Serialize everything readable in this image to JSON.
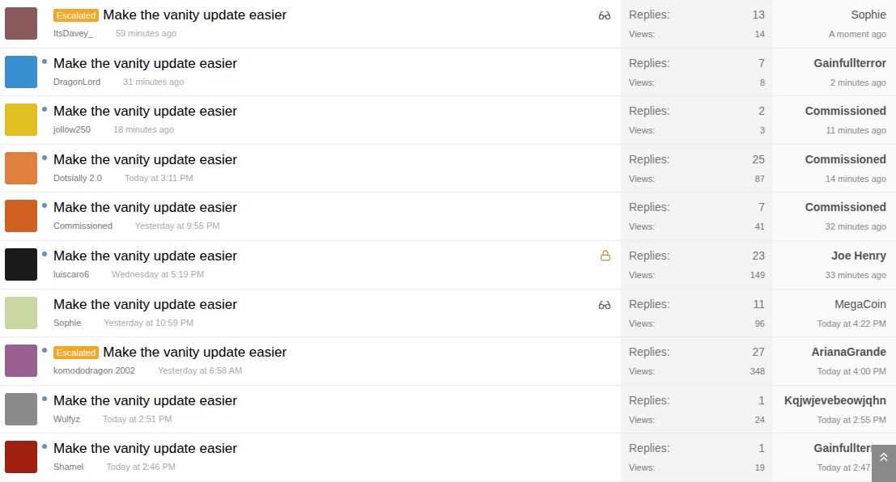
{
  "threads": [
    {
      "badge": "Escalated",
      "title": "Make the vanity update easier",
      "author": "ItsDavey_",
      "started": "59 minutes ago",
      "unread": false,
      "watched": true,
      "locked": false,
      "replies_label": "Replies:",
      "replies": "13",
      "views_label": "Views:",
      "views": "14",
      "last_poster": "Sophie",
      "last_time": "A moment ago",
      "color": "#8a5a5a"
    },
    {
      "badge": "",
      "title": "Make the vanity update easier",
      "author": "DragonLord",
      "started": "31 minutes ago",
      "unread": true,
      "watched": false,
      "locked": false,
      "replies_label": "Replies:",
      "replies": "7",
      "views_label": "Views:",
      "views": "8",
      "last_poster": "Gainfullterror",
      "last_time": "2 minutes ago",
      "color": "#3a8fd0"
    },
    {
      "badge": "",
      "title": "Make the vanity update easier",
      "author": "jollow250",
      "started": "18 minutes ago",
      "unread": true,
      "watched": false,
      "locked": false,
      "replies_label": "Replies:",
      "replies": "2",
      "views_label": "Views:",
      "views": "3",
      "last_poster": "Commissioned",
      "last_time": "11 minutes ago",
      "color": "#e0c020"
    },
    {
      "badge": "",
      "title": "Make the vanity update easier",
      "author": "Dotsially 2.0",
      "started": "Today at 3:11 PM",
      "unread": true,
      "watched": false,
      "locked": false,
      "replies_label": "Replies:",
      "replies": "25",
      "views_label": "Views:",
      "views": "87",
      "last_poster": "Commissioned",
      "last_time": "14 minutes ago",
      "color": "#e08040"
    },
    {
      "badge": "",
      "title": "Make the vanity update easier",
      "author": "Commissioned",
      "started": "Yesterday at 9:55 PM",
      "unread": true,
      "watched": false,
      "locked": false,
      "replies_label": "Replies:",
      "replies": "7",
      "views_label": "Views:",
      "views": "41",
      "last_poster": "Commissioned",
      "last_time": "32 minutes ago",
      "color": "#d06020"
    },
    {
      "badge": "",
      "title": "Make the vanity update easier",
      "author": "luiscaro6",
      "started": "Wednesday at 5:19 PM",
      "unread": true,
      "watched": false,
      "locked": true,
      "replies_label": "Replies:",
      "replies": "23",
      "views_label": "Views:",
      "views": "149",
      "last_poster": "Joe Henry",
      "last_time": "33 minutes ago",
      "color": "#1a1a1a"
    },
    {
      "badge": "",
      "title": "Make the vanity update easier",
      "author": "Sophie",
      "started": "Yesterday at 10:59 PM",
      "unread": false,
      "watched": true,
      "locked": false,
      "replies_label": "Replies:",
      "replies": "11",
      "views_label": "Views:",
      "views": "96",
      "last_poster": "MegaCoin",
      "last_time": "Today at 4:22 PM",
      "color": "#c8d8a0"
    },
    {
      "badge": "Escalated",
      "title": "Make the vanity update easier",
      "author": "komododragon 2002",
      "started": "Yesterday at 6:58 AM",
      "unread": true,
      "watched": false,
      "locked": false,
      "replies_label": "Replies:",
      "replies": "27",
      "views_label": "Views:",
      "views": "348",
      "last_poster": "ArianaGrande",
      "last_time": "Today at 4:00 PM",
      "color": "#9a6090"
    },
    {
      "badge": "",
      "title": "Make the vanity update easier",
      "author": "Wulfyz",
      "started": "Today at 2:51 PM",
      "unread": true,
      "watched": false,
      "locked": false,
      "replies_label": "Replies:",
      "replies": "1",
      "views_label": "Views:",
      "views": "24",
      "last_poster": "Kqjwjevebeowjqhn",
      "last_time": "Today at 2:55 PM",
      "color": "#8a8a8a"
    },
    {
      "badge": "",
      "title": "Make the vanity update easier",
      "author": "Shamel",
      "started": "Today at 2:46 PM",
      "unread": true,
      "watched": false,
      "locked": false,
      "replies_label": "Replies:",
      "replies": "1",
      "views_label": "Views:",
      "views": "19",
      "last_poster": "Gainfullterror",
      "last_time": "Today at 2:47 PM",
      "color": "#a02010"
    }
  ]
}
